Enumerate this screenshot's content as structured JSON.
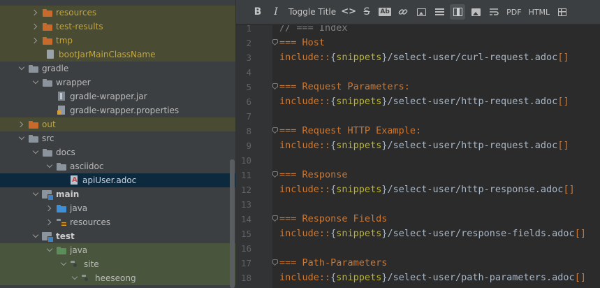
{
  "tree": {
    "items": [
      {
        "label": "resources",
        "state": "collapsed"
      },
      {
        "label": "test-results",
        "state": "collapsed"
      },
      {
        "label": "tmp",
        "state": "collapsed"
      },
      {
        "label": "bootJarMainClassName",
        "state": "leaf"
      },
      {
        "label": "gradle",
        "state": "expanded"
      },
      {
        "label": "wrapper",
        "state": "expanded"
      },
      {
        "label": "gradle-wrapper.jar",
        "state": "leaf"
      },
      {
        "label": "gradle-wrapper.properties",
        "state": "leaf"
      },
      {
        "label": "out",
        "state": "collapsed"
      },
      {
        "label": "src",
        "state": "expanded"
      },
      {
        "label": "docs",
        "state": "expanded"
      },
      {
        "label": "asciidoc",
        "state": "expanded"
      },
      {
        "label": "apiUser.adoc",
        "state": "leaf"
      },
      {
        "label": "main",
        "state": "expanded"
      },
      {
        "label": "java",
        "state": "collapsed"
      },
      {
        "label": "resources",
        "state": "collapsed"
      },
      {
        "label": "test",
        "state": "expanded"
      },
      {
        "label": "java",
        "state": "expanded"
      },
      {
        "label": "site",
        "state": "expanded"
      },
      {
        "label": "heeseong",
        "state": "expanded"
      }
    ],
    "selected": "apiUser.adoc"
  },
  "toolbar": {
    "bold_icon": "B",
    "italic_icon": "I",
    "toggle_title_label": "Toggle Title",
    "code_icon": "<>",
    "strike_icon": "S",
    "ab_icon": "Ab",
    "link_icon": "link-icon",
    "image_icon": "image-icon",
    "list_icon": "list-icon",
    "preview_icon": "split-preview-icon",
    "image2_icon": "image-fill-icon",
    "wrap_icon": "wrap-icon",
    "pdf_label": "PDF",
    "html_label": "HTML",
    "table_icon": "table-icon"
  },
  "editor": {
    "lines": [
      {
        "n": "1",
        "parts": [
          {
            "t": "// === Index",
            "c": "comment"
          }
        ]
      },
      {
        "n": "2",
        "fold": true,
        "parts": [
          {
            "t": "=== Host",
            "c": "heading"
          }
        ]
      },
      {
        "n": "3",
        "parts": [
          {
            "t": "include::",
            "c": "kw"
          },
          {
            "t": "{",
            "c": "brace"
          },
          {
            "t": "snippets",
            "c": "attr"
          },
          {
            "t": "}",
            "c": "brace"
          },
          {
            "t": "/select-user/curl-request.adoc",
            "c": "path"
          },
          {
            "t": "[]",
            "c": "bracket"
          }
        ]
      },
      {
        "n": "4",
        "parts": []
      },
      {
        "n": "5",
        "fold": true,
        "parts": [
          {
            "t": "=== Request Parameters:",
            "c": "heading"
          }
        ]
      },
      {
        "n": "6",
        "parts": [
          {
            "t": "include::",
            "c": "kw"
          },
          {
            "t": "{",
            "c": "brace"
          },
          {
            "t": "snippets",
            "c": "attr"
          },
          {
            "t": "}",
            "c": "brace"
          },
          {
            "t": "/select-user/http-request.adoc",
            "c": "path"
          },
          {
            "t": "[]",
            "c": "bracket"
          }
        ]
      },
      {
        "n": "7",
        "parts": []
      },
      {
        "n": "8",
        "fold": true,
        "parts": [
          {
            "t": "=== Request HTTP Example:",
            "c": "heading"
          }
        ]
      },
      {
        "n": "9",
        "parts": [
          {
            "t": "include::",
            "c": "kw"
          },
          {
            "t": "{",
            "c": "brace"
          },
          {
            "t": "snippets",
            "c": "attr"
          },
          {
            "t": "}",
            "c": "brace"
          },
          {
            "t": "/select-user/http-request.adoc",
            "c": "path"
          },
          {
            "t": "[]",
            "c": "bracket"
          }
        ]
      },
      {
        "n": "10",
        "parts": []
      },
      {
        "n": "11",
        "fold": true,
        "parts": [
          {
            "t": "=== Response",
            "c": "heading"
          }
        ]
      },
      {
        "n": "12",
        "parts": [
          {
            "t": "include::",
            "c": "kw"
          },
          {
            "t": "{",
            "c": "brace"
          },
          {
            "t": "snippets",
            "c": "attr"
          },
          {
            "t": "}",
            "c": "brace"
          },
          {
            "t": "/select-user/http-response.adoc",
            "c": "path"
          },
          {
            "t": "[]",
            "c": "bracket"
          }
        ]
      },
      {
        "n": "13",
        "parts": []
      },
      {
        "n": "14",
        "fold": true,
        "parts": [
          {
            "t": "=== Response Fields",
            "c": "heading"
          }
        ]
      },
      {
        "n": "15",
        "parts": [
          {
            "t": "include::",
            "c": "kw"
          },
          {
            "t": "{",
            "c": "brace"
          },
          {
            "t": "snippets",
            "c": "attr"
          },
          {
            "t": "}",
            "c": "brace"
          },
          {
            "t": "/select-user/response-fields.adoc",
            "c": "path"
          },
          {
            "t": "[]",
            "c": "bracket"
          }
        ]
      },
      {
        "n": "16",
        "parts": []
      },
      {
        "n": "17",
        "fold": true,
        "parts": [
          {
            "t": "=== Path-Parameters",
            "c": "heading"
          }
        ]
      },
      {
        "n": "18",
        "parts": [
          {
            "t": "include::",
            "c": "kw"
          },
          {
            "t": "{",
            "c": "brace"
          },
          {
            "t": "snippets",
            "c": "attr"
          },
          {
            "t": "}",
            "c": "brace"
          },
          {
            "t": "/select-user/path-parameters.adoc",
            "c": "path"
          },
          {
            "t": "[]",
            "c": "bracket"
          }
        ]
      }
    ]
  }
}
